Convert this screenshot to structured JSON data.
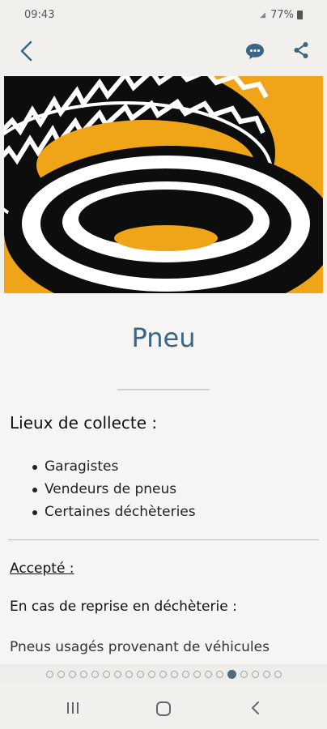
{
  "status_bar": {
    "time": "09:43",
    "battery": "77%"
  },
  "app_bar": {
    "back_icon": "back-arrow-icon",
    "chat_icon": "chat-bubble-icon",
    "share_icon": "share-icon",
    "accent_color": "#3b6580"
  },
  "hero": {
    "image": "tire illustration",
    "background_color": "#f0a417"
  },
  "item": {
    "title": "Pneu",
    "collect_heading": "Lieux de collecte :",
    "collect_places": [
      "Garagistes",
      "Vendeurs de pneus",
      "Certaines déchèteries"
    ],
    "accepted_label": "Accepté :",
    "reprise_heading": "En cas de reprise en déchèterie :",
    "reprise_text": "Pneus usagés provenant de véhicules"
  },
  "pager": {
    "total": 21,
    "active_index": 16
  },
  "nav_bar": {
    "recents_icon": "recents-icon",
    "home_icon": "home-icon",
    "back_icon": "nav-back-icon"
  }
}
